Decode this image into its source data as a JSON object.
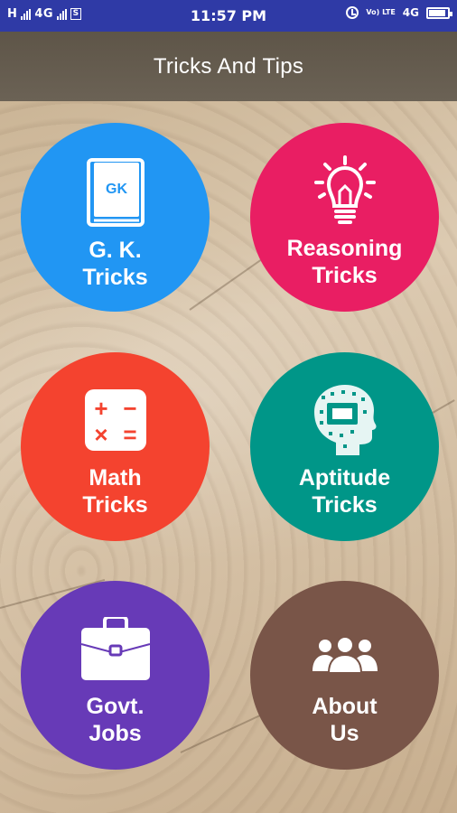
{
  "status_bar": {
    "left_text": "H",
    "network": "4G",
    "time": "11:57 PM",
    "volte": "Vo) LTE",
    "network2": "4G",
    "battery_level": 0.9
  },
  "toolbar": {
    "title": "Tricks And Tips"
  },
  "tiles": [
    {
      "id": "gk",
      "line1": "G. K.",
      "line2": "Tricks",
      "icon": "book-icon",
      "icon_text": "GK",
      "color": "#2196f3"
    },
    {
      "id": "reasoning",
      "line1": "Reasoning",
      "line2": "Tricks",
      "icon": "lightbulb-icon",
      "color": "#e91e63"
    },
    {
      "id": "math",
      "line1": "Math",
      "line2": "Tricks",
      "icon": "calculator-icon",
      "symbols": [
        "+",
        "−",
        "×",
        "="
      ],
      "color": "#f4432f"
    },
    {
      "id": "aptitude",
      "line1": "Aptitude",
      "line2": "Tricks",
      "icon": "head-circuit-icon",
      "color": "#009688"
    },
    {
      "id": "govt",
      "line1": "Govt.",
      "line2": "Jobs",
      "icon": "briefcase-icon",
      "color": "#673ab7"
    },
    {
      "id": "about",
      "line1": "About",
      "line2": "Us",
      "icon": "people-group-icon",
      "color": "#795548"
    }
  ]
}
